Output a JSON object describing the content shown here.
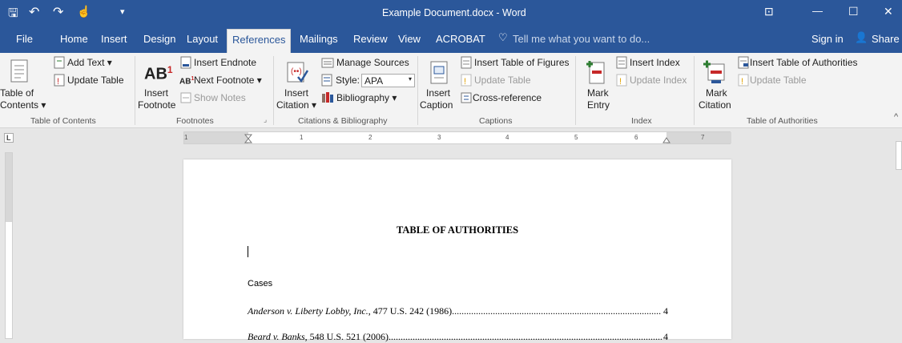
{
  "window": {
    "title": "Example Document.docx - Word",
    "controls": {
      "ribbon_display": "⊡",
      "minimize": "—",
      "maximize": "☐",
      "close": "✕"
    }
  },
  "quick_access": {
    "save": "🖫",
    "undo": "↶",
    "redo": "↷",
    "touch": "☝",
    "customize": "▾"
  },
  "tabs": [
    "File",
    "Home",
    "Insert",
    "Design",
    "Layout",
    "References",
    "Mailings",
    "Review",
    "View",
    "ACROBAT"
  ],
  "active_tab": "References",
  "tell_me": {
    "icon": "♡",
    "placeholder": "Tell me what you want to do..."
  },
  "account": {
    "sign_in": "Sign in",
    "share_icon": "👤",
    "share": "Share"
  },
  "ribbon": {
    "toc": {
      "table_of_label_1": "Table of",
      "table_of_label_2": "Contents ▾",
      "add_text": "Add Text ▾",
      "update_table": "Update Table",
      "group": "Table of Contents"
    },
    "footnotes": {
      "insert_footnote_1": "Insert",
      "insert_footnote_2": "Footnote",
      "ab_glyph": "AB",
      "ab_sup": "1",
      "insert_endnote": "Insert Endnote",
      "next_footnote": "Next Footnote ▾",
      "show_notes": "Show Notes",
      "group": "Footnotes",
      "launcher": "⌟"
    },
    "citations": {
      "insert_citation_1": "Insert",
      "insert_citation_2": "Citation ▾",
      "manage_sources": "Manage Sources",
      "style_label": "Style:",
      "style_value": "APA",
      "bibliography": "Bibliography ▾",
      "group": "Citations & Bibliography"
    },
    "captions": {
      "insert_caption_1": "Insert",
      "insert_caption_2": "Caption",
      "insert_tof": "Insert Table of Figures",
      "update_table": "Update Table",
      "cross_reference": "Cross-reference",
      "group": "Captions"
    },
    "index": {
      "mark_entry_1": "Mark",
      "mark_entry_2": "Entry",
      "insert_index": "Insert Index",
      "update_index": "Update Index",
      "group": "Index"
    },
    "authorities": {
      "mark_citation_1": "Mark",
      "mark_citation_2": "Citation",
      "insert_toa": "Insert Table of Authorities",
      "update_table": "Update Table",
      "group": "Table of Authorities"
    },
    "collapse": "^"
  },
  "ruler": {
    "tab_selector": "L",
    "numbers": [
      "1",
      "1",
      "2",
      "3",
      "4",
      "5",
      "6",
      "7"
    ]
  },
  "document": {
    "heading": "TABLE OF AUTHORITIES",
    "section": "Cases",
    "entries": [
      {
        "name": "Anderson v. Liberty Lobby, Inc.",
        "cite": ", 477 U.S. 242 (1986)",
        "page": "4"
      },
      {
        "name": "Beard v. Banks",
        "cite": ", 548 U.S. 521 (2006)",
        "page": "4"
      }
    ]
  },
  "colors": {
    "word_blue": "#2b579a",
    "ribbon_bg": "#f3f3f3",
    "canvas_bg": "#e6e6e6"
  }
}
